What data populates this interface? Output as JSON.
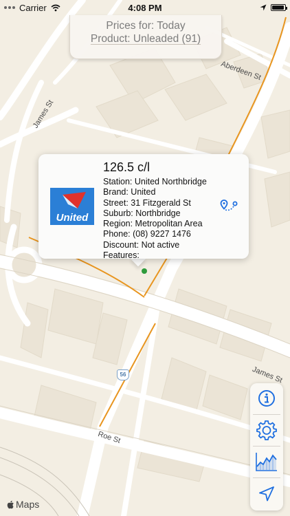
{
  "status_bar": {
    "carrier": "Carrier",
    "time": "4:08 PM",
    "battery_level": 0.95
  },
  "header": {
    "prices_for": "Prices for: Today",
    "product": "Product: Unleaded (91)"
  },
  "callout": {
    "price": "126.5 c/l",
    "station": "Station: United Northbridge",
    "brand": "Brand: United",
    "street": "Street: 31 Fitzgerald St",
    "suburb": "Suburb: Northbridge",
    "region": "Region: Metropolitan Area",
    "phone": "Phone: (08) 9227 1476",
    "discount": "Discount: Not active",
    "features": "Features:",
    "logo_text": "United",
    "logo_color": "#2b7fd6",
    "logo_accent": "#e0322c"
  },
  "map": {
    "roads": {
      "aberdeen": "Aberdeen St",
      "james_top": "James St",
      "james_right": "James St",
      "roe": "Roe St"
    },
    "route_shield": "56",
    "credit": "Maps",
    "route_color": "#e8951f",
    "marker_color": "#2e9b3c"
  },
  "toolbar": {
    "icons": [
      "info-icon",
      "gear-icon",
      "chart-icon",
      "location-arrow-icon"
    ],
    "accent": "#1f6fe0"
  }
}
